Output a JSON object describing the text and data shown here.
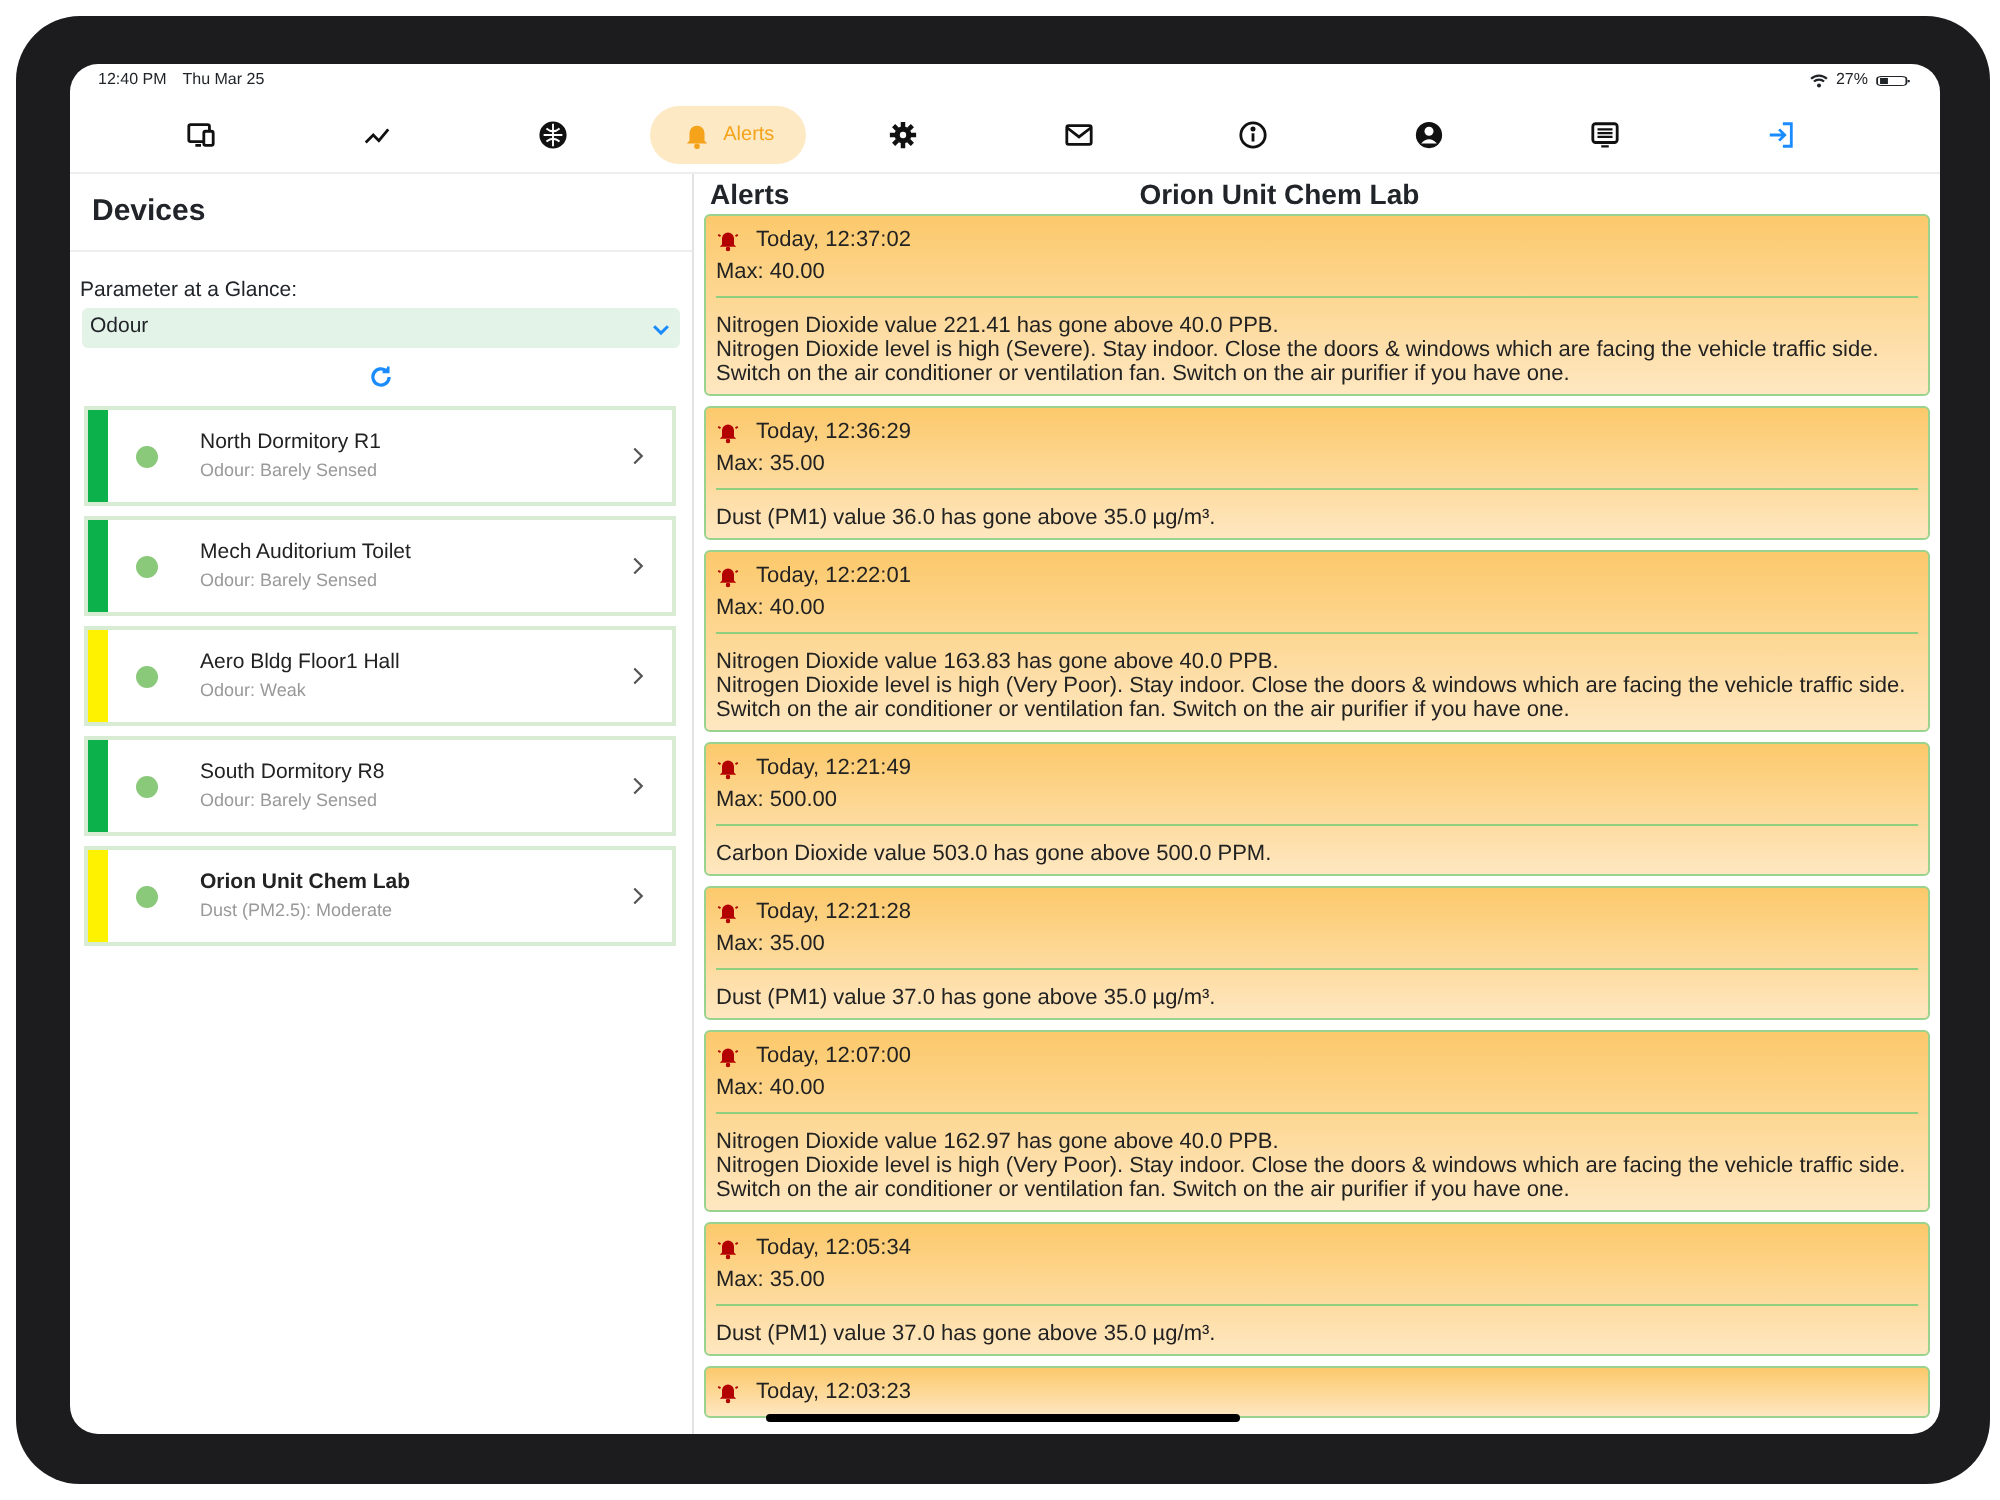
{
  "status_bar": {
    "time": "12:40 PM",
    "date": "Thu Mar 25",
    "battery": "27%"
  },
  "tabs": [
    {
      "kind": "devices",
      "selected": false
    },
    {
      "kind": "chart",
      "selected": false
    },
    {
      "kind": "globe",
      "selected": false
    },
    {
      "kind": "alerts",
      "label": "Alerts",
      "selected": true
    },
    {
      "kind": "settings",
      "selected": false
    },
    {
      "kind": "mail",
      "selected": false
    },
    {
      "kind": "info",
      "selected": false
    },
    {
      "kind": "account",
      "selected": false
    },
    {
      "kind": "screen",
      "selected": false
    },
    {
      "kind": "logout",
      "selected": false
    }
  ],
  "devices_panel": {
    "title": "Devices",
    "parameter_label": "Parameter at a Glance:",
    "parameter_value": "Odour",
    "devices": [
      {
        "name": "North Dormitory R1",
        "status": "Odour: Barely Sensed",
        "color": "#0db14b",
        "selected": false
      },
      {
        "name": "Mech Auditorium Toilet",
        "status": "Odour: Barely Sensed",
        "color": "#0db14b",
        "selected": false
      },
      {
        "name": "Aero Bldg Floor1 Hall",
        "status": "Odour: Weak",
        "color": "#fff200",
        "selected": false
      },
      {
        "name": "South Dormitory R8",
        "status": "Odour: Barely Sensed",
        "color": "#0db14b",
        "selected": false
      },
      {
        "name": "Orion Unit Chem Lab",
        "status": "Dust (PM2.5): Moderate",
        "color": "#fff200",
        "selected": true
      }
    ]
  },
  "alerts_panel": {
    "title": "Alerts",
    "device_name": "Orion Unit Chem Lab",
    "alerts": [
      {
        "time": "Today, 12:37:02",
        "max": "Max: 40.00",
        "lines": [
          "Nitrogen Dioxide value 221.41 has gone above 40.0 PPB.",
          "Nitrogen Dioxide level is high (Severe). Stay indoor. Close the doors & windows which are facing the vehicle traffic side. Switch on the air conditioner or ventilation fan. Switch on the air purifier if you have one."
        ]
      },
      {
        "time": "Today, 12:36:29",
        "max": "Max: 35.00",
        "lines": [
          "Dust (PM1) value 36.0 has gone above 35.0 µg/m³."
        ]
      },
      {
        "time": "Today, 12:22:01",
        "max": "Max: 40.00",
        "lines": [
          "Nitrogen Dioxide value 163.83 has gone above 40.0 PPB.",
          "Nitrogen Dioxide level is high (Very Poor). Stay indoor. Close the doors & windows which are facing the vehicle traffic side. Switch on the air conditioner or ventilation fan. Switch on the air purifier if you have one."
        ]
      },
      {
        "time": "Today, 12:21:49",
        "max": "Max: 500.00",
        "lines": [
          "Carbon Dioxide value 503.0 has gone above 500.0 PPM."
        ]
      },
      {
        "time": "Today, 12:21:28",
        "max": "Max: 35.00",
        "lines": [
          "Dust (PM1) value 37.0 has gone above 35.0 µg/m³."
        ]
      },
      {
        "time": "Today, 12:07:00",
        "max": "Max: 40.00",
        "lines": [
          "Nitrogen Dioxide value 162.97 has gone above 40.0 PPB.",
          "Nitrogen Dioxide level is high (Very Poor). Stay indoor. Close the doors & windows which are facing the vehicle traffic side. Switch on the air conditioner or ventilation fan. Switch on the air purifier if you have one."
        ]
      },
      {
        "time": "Today, 12:05:34",
        "max": "Max: 35.00",
        "lines": [
          "Dust (PM1) value 37.0 has gone above 35.0 µg/m³."
        ]
      },
      {
        "time": "Today, 12:03:23"
      }
    ]
  }
}
